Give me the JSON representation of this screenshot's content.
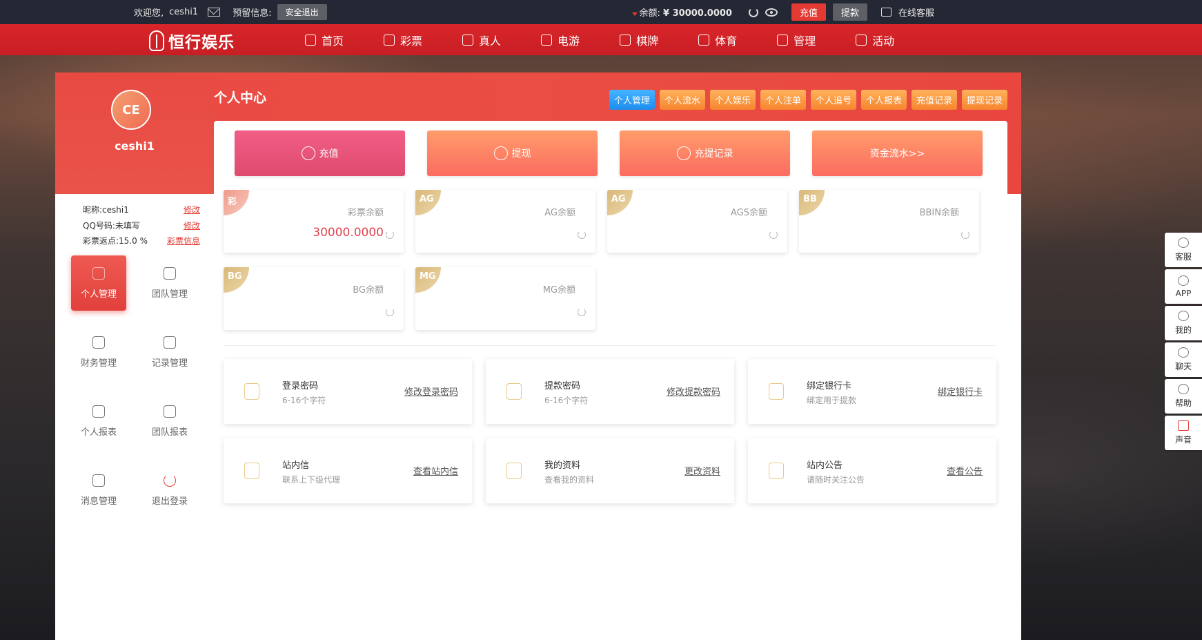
{
  "topbar": {
    "welcome": "欢迎您,",
    "username": "ceshi1",
    "reserved_label": "预留信息:",
    "logout_btn": "安全退出",
    "balance_label": "余额:",
    "balance_value": "¥ 30000.0000",
    "recharge_btn": "充值",
    "withdraw_btn": "提款",
    "support_label": "在线客服"
  },
  "navbar": {
    "logo_text": "恒行娱乐",
    "items": [
      {
        "label": "首页",
        "icon": "home-icon"
      },
      {
        "label": "彩票",
        "icon": "ticket-icon"
      },
      {
        "label": "真人",
        "icon": "casino-icon"
      },
      {
        "label": "电游",
        "icon": "slot-icon"
      },
      {
        "label": "棋牌",
        "icon": "cards-icon"
      },
      {
        "label": "体育",
        "icon": "soccer-icon"
      },
      {
        "label": "管理",
        "icon": "layers-icon"
      },
      {
        "label": "活动",
        "icon": "gift-icon"
      }
    ]
  },
  "sidebar": {
    "avatar_initials": "CE",
    "username": "ceshi1",
    "info": [
      {
        "label": "昵称:ceshi1",
        "link": "修改"
      },
      {
        "label": "QQ号码:未填写",
        "link": "修改"
      },
      {
        "label": "彩票返点:15.0 %",
        "link": "彩票信息"
      }
    ],
    "menu": [
      {
        "label": "个人管理",
        "active": true
      },
      {
        "label": "团队管理",
        "active": false
      },
      {
        "label": "财务管理",
        "active": false
      },
      {
        "label": "记录管理",
        "active": false
      },
      {
        "label": "个人报表",
        "active": false
      },
      {
        "label": "团队报表",
        "active": false
      },
      {
        "label": "消息管理",
        "active": false
      },
      {
        "label": "退出登录",
        "active": false
      }
    ]
  },
  "main": {
    "page_title": "个人中心",
    "tabs": [
      {
        "label": "个人管理",
        "active": true
      },
      {
        "label": "个人流水"
      },
      {
        "label": "个人娱乐"
      },
      {
        "label": "个人注单"
      },
      {
        "label": "个人追号"
      },
      {
        "label": "个人报表"
      },
      {
        "label": "充值记录"
      },
      {
        "label": "提现记录"
      }
    ],
    "actions": [
      {
        "label": "充值",
        "icon": "yuan-plus-icon"
      },
      {
        "label": "提现",
        "icon": "yuan-icon"
      },
      {
        "label": "充提记录",
        "icon": "exchange-icon"
      },
      {
        "label": "资金流水>>",
        "icon": ""
      }
    ],
    "wallets": [
      {
        "badge": "彩",
        "name": "彩票余额",
        "value": "30000.0000"
      },
      {
        "badge": "AG",
        "name": "AG余额",
        "value": ""
      },
      {
        "badge": "AG",
        "name": "AGS余额",
        "value": ""
      },
      {
        "badge": "BB",
        "name": "BBIN余额",
        "value": ""
      },
      {
        "badge": "BG",
        "name": "BG余额",
        "value": ""
      },
      {
        "badge": "MG",
        "name": "MG余额",
        "value": ""
      }
    ],
    "cards": [
      {
        "title": "登录密码",
        "sub": "6-16个字符",
        "link": "修改登录密码",
        "icon": "lock-icon"
      },
      {
        "title": "提款密码",
        "sub": "6-16个字符",
        "link": "修改提款密码",
        "icon": "shield-icon"
      },
      {
        "title": "绑定银行卡",
        "sub": "绑定用于提款",
        "link": "绑定银行卡",
        "icon": "wallet-icon"
      },
      {
        "title": "站内信",
        "sub": "联系上下级代理",
        "link": "查看站内信",
        "icon": "message-icon"
      },
      {
        "title": "我的资料",
        "sub": "查看我的资料",
        "link": "更改资料",
        "icon": "profile-icon"
      },
      {
        "title": "站内公告",
        "sub": "请随时关注公告",
        "link": "查看公告",
        "icon": "speaker-icon"
      }
    ]
  },
  "floatbar": [
    {
      "label": "客服",
      "icon": "headset-icon"
    },
    {
      "label": "APP",
      "icon": "app-icon"
    },
    {
      "label": "我的",
      "icon": "user-icon"
    },
    {
      "label": "聊天",
      "icon": "chat-icon"
    },
    {
      "label": "帮助",
      "icon": "help-icon"
    },
    {
      "label": "声音",
      "icon": "sound-icon"
    }
  ]
}
